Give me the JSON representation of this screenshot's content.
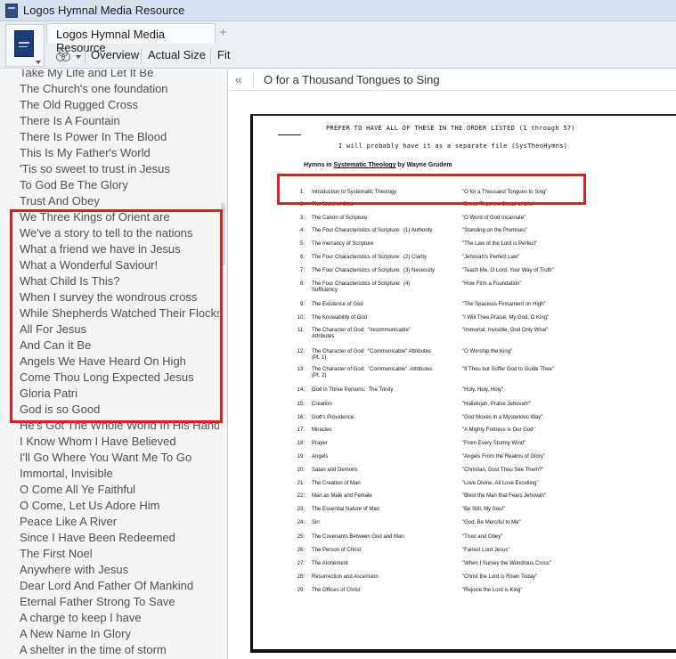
{
  "window": {
    "title": "Logos Hymnal Media Resource",
    "app_icon": "logos-app-icon"
  },
  "tabs": {
    "main_label": "Logos Hymnal Media Resource",
    "add_label": "+"
  },
  "toolbar": {
    "visual_filter_icon": "visual-filter-icon",
    "overview_label": "Overview",
    "actual_size_label": "Actual Size",
    "fit_label": "Fit"
  },
  "sidebar": {
    "items": [
      "Take My Life and Let It Be",
      "The Church's one foundation",
      "The Old Rugged Cross",
      "There Is A Fountain",
      "There Is Power In The Blood",
      "This Is My Father's World",
      "'Tis so sweet to trust in Jesus",
      "To God Be The Glory",
      "Trust And Obey",
      "We Three Kings of Orient are",
      "We've a story to tell to the nations",
      "What a friend we have in Jesus",
      "What a Wonderful Saviour!",
      "What Child Is This?",
      "When I survey the wondrous cross",
      "While Shepherds Watched Their Flocks",
      "All For Jesus",
      "And Can it Be",
      "Angels We Have Heard On High",
      "Come Thou Long Expected Jesus",
      "Gloria Patri",
      "God is so Good",
      "He's Got The Whole World In His Hands",
      "I Know Whom I Have Believed",
      "I'll Go Where You Want Me To Go",
      "Immortal,  Invisible",
      "O Come All Ye Faithful",
      "O Come, Let Us Adore Him",
      "Peace Like A River",
      "Since I Have Been Redeemed",
      "The First Noel",
      "Anywhere with Jesus",
      "Dear Lord And Father Of Mankind",
      "Eternal Father Strong To Save",
      "A charge to keep I have",
      "A New Name In Glory",
      "A shelter in the time of storm"
    ]
  },
  "article": {
    "collapse_label": "«",
    "title": "O for a Thousand Tongues to Sing"
  },
  "document": {
    "handwritten_line1": "PREFER TO HAVE ALL OF THESE IN THE ORDER LISTED (1 through 57)",
    "handwritten_line2": "I will probably have it as a separate file (SysTheoHymns)",
    "heading_prefix": "Hymns in ",
    "heading_book": "Systematic Theology",
    "heading_suffix": " by Wayne Grudem",
    "rows": [
      {
        "num": "1:",
        "topic": "Introduction to Systematic Theology",
        "hymn": "\"O for a Thousand Tongues to Sing\""
      },
      {
        "num": "2:",
        "topic": "The Word of God",
        "hymn": "\"Break Thou the Bread of Life\""
      },
      {
        "num": "3:",
        "topic": "The Canon of Scripture",
        "hymn": "\"O Word of God Incarnate\""
      },
      {
        "num": "4:",
        "topic": "The Four Characteristics of Scripture:  (1) Authority",
        "hymn": "\"Standing on the Promises\""
      },
      {
        "num": "5:",
        "topic": "The Inerrancy of Scripture",
        "hymn": "\"The Law of the Lord is Perfect\""
      },
      {
        "num": "6:",
        "topic": "The Four Characteristics of Scripture:  (2) Clarity",
        "hymn": "\"Jehovah's Perfect Law\""
      },
      {
        "num": "7:",
        "topic": "The Four Characteristics of Scripture:  (3) Necessity",
        "hymn": "\"Teach Me, O Lord, Your Way of Truth\""
      },
      {
        "num": "8:",
        "topic": "The Four Characteristics of Scripture:  (4)\nSufficiency",
        "hymn": "\"How Firm a Foundation\""
      },
      {
        "num": "9:",
        "topic": "The Existence of God",
        "hymn": "\"The Spacious Firmament on High\""
      },
      {
        "num": "10:",
        "topic": "The Knowability of God",
        "hymn": "\"I Will Thee Praise, My God, O King\""
      },
      {
        "num": "11:",
        "topic": "The Character of God:  \"Incommunicable\"\nAttributes",
        "hymn": "\"Immortal, Invisible, God Only Wise\""
      },
      {
        "num": "12:",
        "topic": "The Character of God:  \"Communicable\" Attributes\n(Pt. 1)",
        "hymn": "\"O Worship the King\""
      },
      {
        "num": "13:",
        "topic": "The Character of God:  \"Communicable\"  Attributes\n(Pt. 2)",
        "hymn": "\"If Thou but Suffer God to Guide Thee\""
      },
      {
        "num": "14:",
        "topic": "God in Three Persons:  The Trinity",
        "hymn": "\"Holy, Holy, Holy\""
      },
      {
        "num": "15:",
        "topic": "Creation",
        "hymn": "\"Hallelujah, Praise Jehovah!\""
      },
      {
        "num": "16:",
        "topic": "God's Providence",
        "hymn": "\"God Moves in a Mysterious Way\""
      },
      {
        "num": "17:",
        "topic": "Miracles",
        "hymn": "\"A Mighty Fortress is Our God\""
      },
      {
        "num": "18:",
        "topic": "Prayer",
        "hymn": "\"From Every Stormy Wind\""
      },
      {
        "num": "19:",
        "topic": "Angels",
        "hymn": "\"Angels From the Realms of Glory\""
      },
      {
        "num": "20:",
        "topic": "Satan and Demons",
        "hymn": "\"Christian, Dost Thou See Them?\""
      },
      {
        "num": "21:",
        "topic": "The Creation of Man",
        "hymn": "\"Love Divine, All Love Excelling\""
      },
      {
        "num": "22:",
        "topic": "Man as Male and Female",
        "hymn": "\"Blest the Man that Fears Jehovah\""
      },
      {
        "num": "23:",
        "topic": "The Essential Nature of Man",
        "hymn": "\"Be Still, My Soul\""
      },
      {
        "num": "24:",
        "topic": "Sin",
        "hymn": "\"God, Be Merciful to Me\""
      },
      {
        "num": "25:",
        "topic": "The Covenants Between God and Man",
        "hymn": "\"Trust and Obey\""
      },
      {
        "num": "26:",
        "topic": "The Person of Christ",
        "hymn": "\"Fairest Lord Jesus\""
      },
      {
        "num": "27:",
        "topic": "The Atonement",
        "hymn": "\"When I Survey the Wondrous Cross\""
      },
      {
        "num": "28:",
        "topic": "Resurrection and Ascension",
        "hymn": "\"Christ the Lord is Risen Today\""
      },
      {
        "num": "29:",
        "topic": "The Offices of Christ",
        "hymn": "\"Rejoice the Lord is King\""
      }
    ]
  },
  "colors": {
    "highlight_red": "#df1f23",
    "list_text": "#505050",
    "titlebar": "#d6e2f0"
  }
}
